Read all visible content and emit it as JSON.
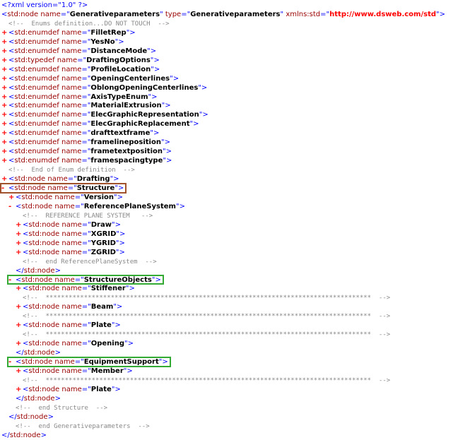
{
  "xml_declaration": "<?xml version=\"1.0\" ?>",
  "lines": [
    {
      "ind": 0,
      "t": "",
      "kind": "pi",
      "text": "<?xml version=\"1.0\" ?>"
    },
    {
      "ind": 0,
      "t": "",
      "kind": "rootopen",
      "tag": "std:node",
      "attrs": [
        [
          "name",
          "Generativeparameters"
        ],
        [
          "type",
          "Generativeparameters"
        ]
      ],
      "ns": [
        "xmlns:std",
        "http://www.dsweb.com/std"
      ]
    },
    {
      "ind": 1,
      "t": "",
      "kind": "comment",
      "text": "<!--  Enums definition...DO NOT TOUCH  -->"
    },
    {
      "ind": 0,
      "t": "+",
      "kind": "el",
      "tag": "std:enumdef",
      "attrs": [
        [
          "name",
          "FilletRep"
        ]
      ]
    },
    {
      "ind": 0,
      "t": "+",
      "kind": "el",
      "tag": "std:enumdef",
      "attrs": [
        [
          "name",
          "YesNo"
        ]
      ]
    },
    {
      "ind": 0,
      "t": "+",
      "kind": "el",
      "tag": "std:enumdef",
      "attrs": [
        [
          "name",
          "DistanceMode"
        ]
      ]
    },
    {
      "ind": 0,
      "t": "+",
      "kind": "el",
      "tag": "std:typedef",
      "attrs": [
        [
          "name",
          "DraftingOptions"
        ]
      ]
    },
    {
      "ind": 0,
      "t": "+",
      "kind": "el",
      "tag": "std:enumdef",
      "attrs": [
        [
          "name",
          "ProfileLocation"
        ]
      ]
    },
    {
      "ind": 0,
      "t": "+",
      "kind": "el",
      "tag": "std:enumdef",
      "attrs": [
        [
          "name",
          "OpeningCenterlines"
        ]
      ]
    },
    {
      "ind": 0,
      "t": "+",
      "kind": "el",
      "tag": "std:enumdef",
      "attrs": [
        [
          "name",
          "OblongOpeningCenterlines"
        ]
      ]
    },
    {
      "ind": 0,
      "t": "+",
      "kind": "el",
      "tag": "std:enumdef",
      "attrs": [
        [
          "name",
          "AxisTypeEnum"
        ]
      ]
    },
    {
      "ind": 0,
      "t": "+",
      "kind": "el",
      "tag": "std:enumdef",
      "attrs": [
        [
          "name",
          "MaterialExtrusion"
        ]
      ]
    },
    {
      "ind": 0,
      "t": "+",
      "kind": "el",
      "tag": "std:enumdef",
      "attrs": [
        [
          "name",
          "ElecGraphicRepresentation"
        ]
      ]
    },
    {
      "ind": 0,
      "t": "+",
      "kind": "el",
      "tag": "std:enumdef",
      "attrs": [
        [
          "name",
          "ElecGraphicReplacement"
        ]
      ]
    },
    {
      "ind": 0,
      "t": "+",
      "kind": "el",
      "tag": "std:enumdef",
      "attrs": [
        [
          "name",
          "drafttextframe"
        ]
      ]
    },
    {
      "ind": 0,
      "t": "+",
      "kind": "el",
      "tag": "std:enumdef",
      "attrs": [
        [
          "name",
          "framelineposition"
        ]
      ]
    },
    {
      "ind": 0,
      "t": "+",
      "kind": "el",
      "tag": "std:enumdef",
      "attrs": [
        [
          "name",
          "frametextposition"
        ]
      ]
    },
    {
      "ind": 0,
      "t": "+",
      "kind": "el",
      "tag": "std:enumdef",
      "attrs": [
        [
          "name",
          "framespacingtype"
        ]
      ]
    },
    {
      "ind": 1,
      "t": "",
      "kind": "comment",
      "text": "<!--  End of Enum definition  -->"
    },
    {
      "ind": 0,
      "t": "+",
      "kind": "el",
      "tag": "std:node",
      "attrs": [
        [
          "name",
          "Drafting"
        ]
      ]
    },
    {
      "ind": 0,
      "t": "-",
      "kind": "el",
      "tag": "std:node",
      "attrs": [
        [
          "name",
          "Structure"
        ]
      ]
    },
    {
      "ind": 1,
      "t": "+",
      "kind": "el",
      "tag": "std:node",
      "attrs": [
        [
          "name",
          "Version"
        ]
      ]
    },
    {
      "ind": 1,
      "t": "-",
      "kind": "el",
      "tag": "std:node",
      "attrs": [
        [
          "name",
          "ReferencePlaneSystem"
        ]
      ]
    },
    {
      "ind": 3,
      "t": "",
      "kind": "comment",
      "text": "<!--  REFERENCE PLANE SYSTEM   -->"
    },
    {
      "ind": 2,
      "t": "+",
      "kind": "el",
      "tag": "std:node",
      "attrs": [
        [
          "name",
          "Draw"
        ]
      ]
    },
    {
      "ind": 2,
      "t": "+",
      "kind": "el",
      "tag": "std:node",
      "attrs": [
        [
          "name",
          "XGRID"
        ]
      ]
    },
    {
      "ind": 2,
      "t": "+",
      "kind": "el",
      "tag": "std:node",
      "attrs": [
        [
          "name",
          "YGRID"
        ]
      ]
    },
    {
      "ind": 2,
      "t": "+",
      "kind": "el",
      "tag": "std:node",
      "attrs": [
        [
          "name",
          "ZGRID"
        ]
      ]
    },
    {
      "ind": 3,
      "t": "",
      "kind": "comment",
      "text": "<!--  end ReferencePlaneSystem  -->"
    },
    {
      "ind": 2,
      "t": "",
      "kind": "close",
      "tag": "std:node"
    },
    {
      "ind": 1,
      "t": "-",
      "kind": "el",
      "tag": "std:node",
      "attrs": [
        [
          "name",
          "StructureObjects"
        ]
      ]
    },
    {
      "ind": 2,
      "t": "+",
      "kind": "el",
      "tag": "std:node",
      "attrs": [
        [
          "name",
          "Stiffener"
        ]
      ]
    },
    {
      "ind": 3,
      "t": "",
      "kind": "comment",
      "text": "<!--  *************************************************************************************  -->"
    },
    {
      "ind": 2,
      "t": "+",
      "kind": "el",
      "tag": "std:node",
      "attrs": [
        [
          "name",
          "Beam"
        ]
      ]
    },
    {
      "ind": 3,
      "t": "",
      "kind": "comment",
      "text": "<!--  *************************************************************************************  -->"
    },
    {
      "ind": 2,
      "t": "+",
      "kind": "el",
      "tag": "std:node",
      "attrs": [
        [
          "name",
          "Plate"
        ]
      ]
    },
    {
      "ind": 3,
      "t": "",
      "kind": "comment",
      "text": "<!--  *************************************************************************************  -->"
    },
    {
      "ind": 2,
      "t": "+",
      "kind": "el",
      "tag": "std:node",
      "attrs": [
        [
          "name",
          "Opening"
        ]
      ]
    },
    {
      "ind": 2,
      "t": "",
      "kind": "close",
      "tag": "std:node"
    },
    {
      "ind": 1,
      "t": "-",
      "kind": "el",
      "tag": "std:node",
      "attrs": [
        [
          "name",
          "EquipmentSupport"
        ]
      ]
    },
    {
      "ind": 2,
      "t": "+",
      "kind": "el",
      "tag": "std:node",
      "attrs": [
        [
          "name",
          "Member"
        ]
      ]
    },
    {
      "ind": 3,
      "t": "",
      "kind": "comment",
      "text": "<!--  *************************************************************************************  -->"
    },
    {
      "ind": 2,
      "t": "+",
      "kind": "el",
      "tag": "std:node",
      "attrs": [
        [
          "name",
          "Plate"
        ]
      ]
    },
    {
      "ind": 2,
      "t": "",
      "kind": "close",
      "tag": "std:node"
    },
    {
      "ind": 2,
      "t": "",
      "kind": "comment",
      "text": "<!--  end Structure  -->"
    },
    {
      "ind": 1,
      "t": "",
      "kind": "close",
      "tag": "std:node"
    },
    {
      "ind": 2,
      "t": "",
      "kind": "comment",
      "text": "<!--  end Generativeparameters  -->"
    },
    {
      "ind": 0,
      "t": "",
      "kind": "close",
      "tag": "std:node"
    }
  ],
  "highlight_colors": {
    "structure": "#a0522d",
    "structure_objects": "#33aa33",
    "equipment_support": "#33aa33"
  },
  "highlight_line_indexes": {
    "structure": 20,
    "structure_objects": 30,
    "equipment_support": 39
  }
}
